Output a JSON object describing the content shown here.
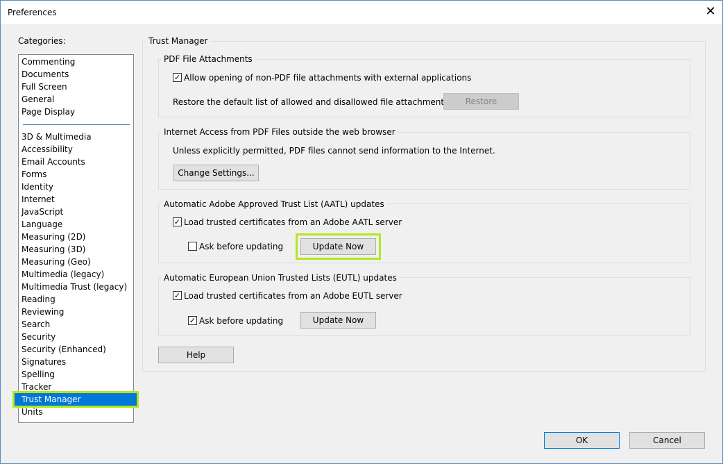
{
  "window": {
    "title": "Preferences",
    "close_icon": "close-icon"
  },
  "categories": {
    "label": "Categories:",
    "group1": [
      "Commenting",
      "Documents",
      "Full Screen",
      "General",
      "Page Display"
    ],
    "group2": [
      "3D & Multimedia",
      "Accessibility",
      "Email Accounts",
      "Forms",
      "Identity",
      "Internet",
      "JavaScript",
      "Language",
      "Measuring (2D)",
      "Measuring (3D)",
      "Measuring (Geo)",
      "Multimedia (legacy)",
      "Multimedia Trust (legacy)",
      "Reading",
      "Reviewing",
      "Search",
      "Security",
      "Security (Enhanced)",
      "Signatures",
      "Spelling",
      "Tracker",
      "Trust Manager",
      "Units"
    ],
    "selected": "Trust Manager"
  },
  "panel": {
    "title": "Trust Manager",
    "attachments": {
      "title": "PDF File Attachments",
      "allow_label": "Allow opening of non-PDF file attachments with external applications",
      "allow_checked": true,
      "restore_text": "Restore the default list of allowed and disallowed file attachment types:",
      "restore_button": "Restore"
    },
    "internet": {
      "title": "Internet Access from PDF Files outside the web browser",
      "text": "Unless explicitly permitted, PDF files cannot send information to the Internet.",
      "change_button": "Change Settings..."
    },
    "aatl": {
      "title": "Automatic Adobe Approved Trust List (AATL) updates",
      "load_label": "Load trusted certificates from an Adobe AATL server",
      "load_checked": true,
      "ask_label": "Ask before updating",
      "ask_checked": false,
      "update_button": "Update Now"
    },
    "eutl": {
      "title": "Automatic European Union Trusted Lists (EUTL) updates",
      "load_label": "Load trusted certificates from an Adobe EUTL server",
      "load_checked": true,
      "ask_label": "Ask before updating",
      "ask_checked": true,
      "update_button": "Update Now"
    },
    "help_button": "Help"
  },
  "footer": {
    "ok": "OK",
    "cancel": "Cancel"
  },
  "highlight_color": "#b5e61d",
  "selection_color": "#0078d7"
}
